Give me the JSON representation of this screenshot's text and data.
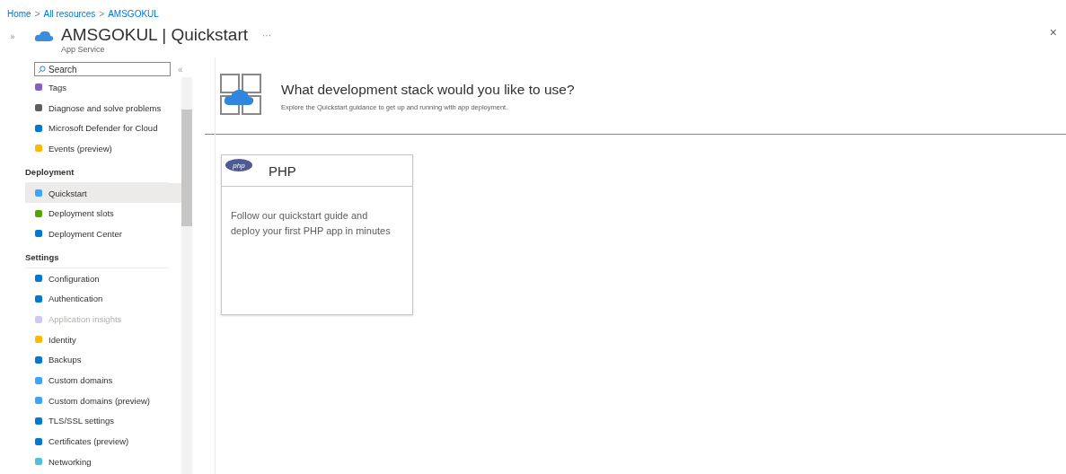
{
  "breadcrumb": {
    "separator": ">",
    "items": [
      "Home",
      "All resources",
      "AMSGOKUL"
    ]
  },
  "header": {
    "title": "AMSGOKUL | Quickstart",
    "subtitle": "App Service",
    "more": "···",
    "close": "×",
    "expand": "»"
  },
  "sidebar": {
    "search": {
      "placeholder": "Search"
    },
    "collapse": "«",
    "items": [
      {
        "kind": "item",
        "label": "Tags",
        "selected": false,
        "disabled": false
      },
      {
        "kind": "item",
        "label": "Diagnose and solve problems",
        "selected": false,
        "disabled": false
      },
      {
        "kind": "item",
        "label": "Microsoft Defender for Cloud",
        "selected": false,
        "disabled": false
      },
      {
        "kind": "item",
        "label": "Events (preview)",
        "selected": false,
        "disabled": false
      },
      {
        "kind": "group",
        "label": "Deployment"
      },
      {
        "kind": "item",
        "label": "Quickstart",
        "selected": true,
        "disabled": false
      },
      {
        "kind": "item",
        "label": "Deployment slots",
        "selected": false,
        "disabled": false
      },
      {
        "kind": "item",
        "label": "Deployment Center",
        "selected": false,
        "disabled": false
      },
      {
        "kind": "group",
        "label": "Settings"
      },
      {
        "kind": "item",
        "label": "Configuration",
        "selected": false,
        "disabled": false
      },
      {
        "kind": "item",
        "label": "Authentication",
        "selected": false,
        "disabled": false
      },
      {
        "kind": "item",
        "label": "Application insights",
        "selected": false,
        "disabled": true
      },
      {
        "kind": "item",
        "label": "Identity",
        "selected": false,
        "disabled": false
      },
      {
        "kind": "item",
        "label": "Backups",
        "selected": false,
        "disabled": false
      },
      {
        "kind": "item",
        "label": "Custom domains",
        "selected": false,
        "disabled": false
      },
      {
        "kind": "item",
        "label": "Custom domains (preview)",
        "selected": false,
        "disabled": false
      },
      {
        "kind": "item",
        "label": "TLS/SSL settings",
        "selected": false,
        "disabled": false
      },
      {
        "kind": "item",
        "label": "Certificates (preview)",
        "selected": false,
        "disabled": false
      },
      {
        "kind": "item",
        "label": "Networking",
        "selected": false,
        "disabled": false
      }
    ]
  },
  "main": {
    "heading": "What development stack would you like to use?",
    "description": "Explore the Quickstart guidance to get up and running with app deployment.",
    "cards": [
      {
        "logo": "php",
        "title": "PHP",
        "body": "Follow our quickstart guide and deploy your first PHP app in minutes"
      }
    ]
  }
}
